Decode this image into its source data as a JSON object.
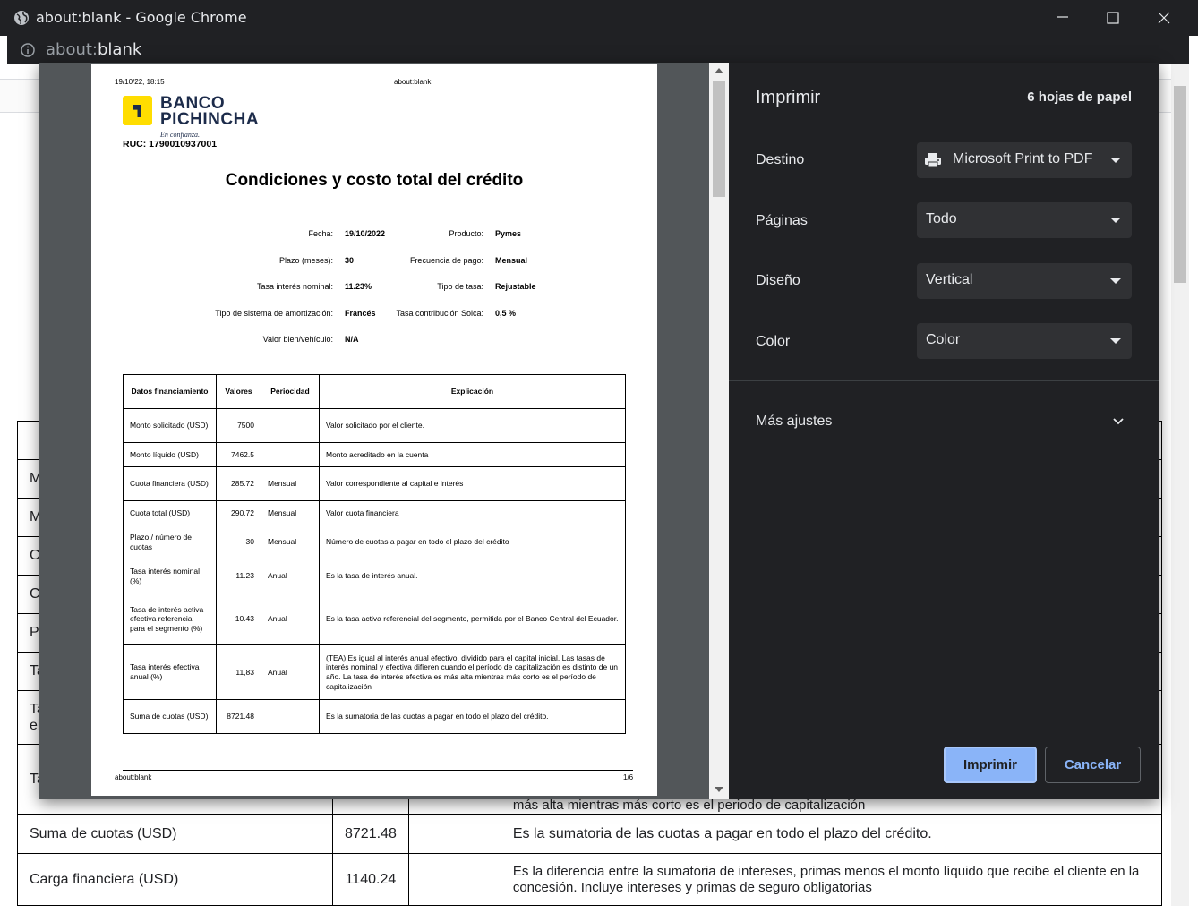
{
  "window": {
    "title": "about:blank - Google Chrome",
    "url_prefix": "about:",
    "url_rest": "blank"
  },
  "background_table": {
    "left_fragments": [
      "M",
      "M",
      "C",
      "C",
      "P",
      "Ta",
      "Ta",
      "el",
      "Ta"
    ],
    "partial_text": "más alta mientras más corto es el periodo de capitalización",
    "rows": [
      {
        "label": "Suma de cuotas (USD)",
        "value": "8721.48",
        "period": "",
        "explanation": "Es la sumatoria de las cuotas a pagar en todo el plazo del crédito."
      },
      {
        "label": "Carga financiera (USD)",
        "value": "1140.24",
        "period": "",
        "explanation": "Es la diferencia entre la sumatoria de intereses, primas menos el monto líquido que recibe el cliente en la concesión. Incluye intereses y primas de seguro obligatorias"
      }
    ]
  },
  "preview": {
    "header_date": "19/10/22, 18:15",
    "header_url": "about:blank",
    "logo_line1": "BANCO",
    "logo_line2": "PICHINCHA",
    "logo_tagline": "En confianza.",
    "ruc": "RUC: 1790010937001",
    "title": "Condiciones y costo total del crédito",
    "fields": {
      "fecha_label": "Fecha:",
      "fecha_value": "19/10/2022",
      "producto_label": "Producto:",
      "producto_value": "Pymes",
      "plazo_label": "Plazo (meses):",
      "plazo_value": "30",
      "frecuencia_label": "Frecuencia de pago:",
      "frecuencia_value": "Mensual",
      "tasa_nominal_label": "Tasa interés nominal:",
      "tasa_nominal_value": "11.23%",
      "tipo_tasa_label": "Tipo de tasa:",
      "tipo_tasa_value": "Rejustable",
      "amortizacion_label": "Tipo de sistema de amortización:",
      "amortizacion_value": "Francés",
      "solca_label": "Tasa contribución Solca:",
      "solca_value": "0,5 %",
      "valor_bien_label": "Valor bien/vehículo:",
      "valor_bien_value": "N/A"
    },
    "table_headers": [
      "Datos financiamiento",
      "Valores",
      "Periocidad",
      "Explicación"
    ],
    "table_rows": [
      {
        "dato": "Monto solicitado (USD)",
        "valor": "7500",
        "periodo": "",
        "explicacion": "Valor solicitado por el cliente."
      },
      {
        "dato": "Monto líquido (USD)",
        "valor": "7462.5",
        "periodo": "",
        "explicacion": "Monto acreditado en la cuenta"
      },
      {
        "dato": "Cuota financiera (USD)",
        "valor": "285.72",
        "periodo": "Mensual",
        "explicacion": "Valor correspondiente al capital e interés"
      },
      {
        "dato": "Cuota total (USD)",
        "valor": "290.72",
        "periodo": "Mensual",
        "explicacion": "Valor cuota financiera"
      },
      {
        "dato": "Plazo / número de cuotas",
        "valor": "30",
        "periodo": "Mensual",
        "explicacion": "Número de cuotas a pagar en todo el plazo del crédito"
      },
      {
        "dato": "Tasa interés nominal (%)",
        "valor": "11.23",
        "periodo": "Anual",
        "explicacion": "Es la tasa de interés anual."
      },
      {
        "dato": "Tasa de interés activa efectiva referencial para el segmento (%)",
        "valor": "10.43",
        "periodo": "Anual",
        "explicacion": "Es la tasa activa referencial del segmento, permitida por el Banco Central del Ecuador."
      },
      {
        "dato": "Tasa interés efectiva anual (%)",
        "valor": "11,83",
        "periodo": "Anual",
        "explicacion": "(TEA) Es igual al interés anual efectivo, dividido para el capital inicial. Las tasas de interés nominal y efectiva difieren cuando el período de capitalización es distinto de un año. La tasa de interés efectiva es más alta mientras más corto es el período de capitalización"
      },
      {
        "dato": "Suma de cuotas (USD)",
        "valor": "8721.48",
        "periodo": "",
        "explicacion": "Es la sumatoria de las cuotas a pagar en todo el plazo del crédito."
      }
    ],
    "footer_url": "about:blank",
    "footer_page": "1/6"
  },
  "print_settings": {
    "title": "Imprimir",
    "sheets": "6 hojas de papel",
    "destino_label": "Destino",
    "destino_value": "Microsoft Print to PDF",
    "paginas_label": "Páginas",
    "paginas_value": "Todo",
    "diseno_label": "Diseño",
    "diseno_value": "Vertical",
    "color_label": "Color",
    "color_value": "Color",
    "more_settings": "Más ajustes",
    "print_button": "Imprimir",
    "cancel_button": "Cancelar"
  },
  "colors": {
    "dialog_bg": "#202124",
    "accent": "#8ab4f8",
    "brand_yellow": "#ffdd00",
    "brand_navy": "#1c2b4a"
  }
}
